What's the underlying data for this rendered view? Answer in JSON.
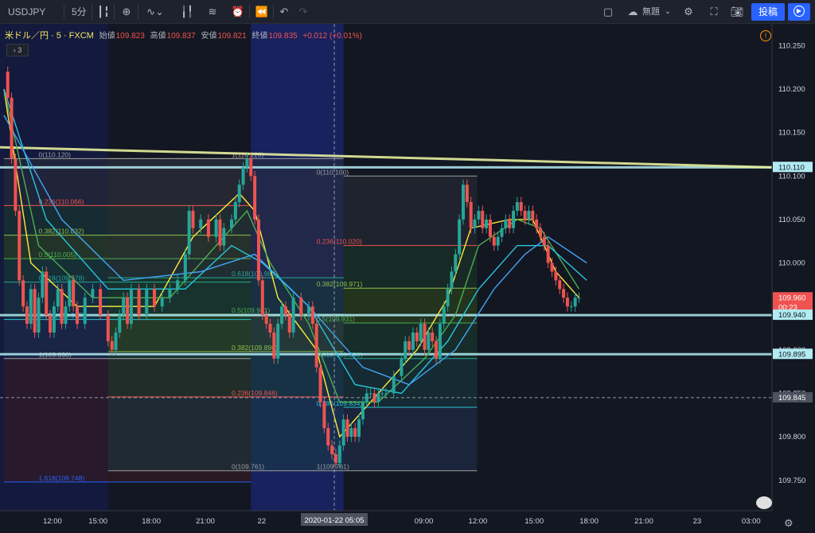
{
  "toolbar": {
    "symbol": "USDJPY",
    "interval": "5分",
    "autosave_label": "無題",
    "post_label": "投稿",
    "icons": [
      "candles-icon",
      "plus-circle-icon",
      "indicator-icon",
      "bar-chart-icon",
      "fib-icon",
      "alert-icon",
      "replay-icon",
      "undo-icon",
      "redo-icon",
      "square-icon",
      "cloud-icon",
      "gear-icon",
      "fullscreen-icon",
      "camera-icon",
      "play-icon"
    ]
  },
  "legend": {
    "symbol_desc": "米ドル／円 · 5 · FXCM",
    "open_label": "始値",
    "open": "109.823",
    "high_label": "高値",
    "high": "109.837",
    "low_label": "安値",
    "low": "109.821",
    "close_label": "終値",
    "close": "109.835",
    "change": "+0.012 (+0.01%)",
    "collapse": "› 3"
  },
  "colors": {
    "up": "#26a69a",
    "down": "#ef5350",
    "bg": "#131722",
    "cursor_bar": "#4c525e"
  },
  "chart_data": {
    "type": "line",
    "title": "",
    "ylabel": "",
    "xlabel": "",
    "ylim": [
      109.715,
      110.275
    ],
    "xlim": [
      0,
      100
    ],
    "grid": false,
    "x_ticks": [
      {
        "label": "12:00",
        "x": 6.8
      },
      {
        "label": "15:00",
        "x": 12.7
      },
      {
        "label": "18:00",
        "x": 19.6
      },
      {
        "label": "21:00",
        "x": 26.6
      },
      {
        "label": "22",
        "x": 33.9
      },
      {
        "label": "03:00",
        "x": 40.6
      },
      {
        "label": "09:00",
        "x": 54.9
      },
      {
        "label": "12:00",
        "x": 61.9
      },
      {
        "label": "15:00",
        "x": 69.2
      },
      {
        "label": "18:00",
        "x": 76.3
      },
      {
        "label": "21:00",
        "x": 83.4
      },
      {
        "label": "23",
        "x": 90.3
      },
      {
        "label": "03:00",
        "x": 97.3
      }
    ],
    "y_ticks": [
      "110.250",
      "110.200",
      "110.150",
      "110.100",
      "110.050",
      "110.000",
      "109.950",
      "109.900",
      "109.850",
      "109.800",
      "109.750"
    ],
    "price_series": [
      [
        0.5,
        110.22
      ],
      [
        1,
        110.19
      ],
      [
        1.5,
        110.12
      ],
      [
        2,
        110.06
      ],
      [
        2.5,
        109.98
      ],
      [
        3,
        109.95
      ],
      [
        3.5,
        109.93
      ],
      [
        4,
        109.97
      ],
      [
        4.5,
        109.92
      ],
      [
        5,
        109.96
      ],
      [
        5.5,
        109.99
      ],
      [
        6,
        109.94
      ],
      [
        6.5,
        109.92
      ],
      [
        7,
        109.95
      ],
      [
        7.5,
        109.97
      ],
      [
        8,
        109.93
      ],
      [
        8.5,
        109.95
      ],
      [
        9,
        109.98
      ],
      [
        9.5,
        109.95
      ],
      [
        10,
        109.93
      ],
      [
        11,
        109.96
      ],
      [
        12,
        109.97
      ],
      [
        13,
        109.94
      ],
      [
        14,
        109.91
      ],
      [
        14.5,
        109.9
      ],
      [
        15,
        109.92
      ],
      [
        15.5,
        109.94
      ],
      [
        16,
        109.96
      ],
      [
        16.5,
        109.93
      ],
      [
        17,
        109.97
      ],
      [
        18,
        109.94
      ],
      [
        19,
        109.97
      ],
      [
        20,
        109.95
      ],
      [
        21,
        109.96
      ],
      [
        22,
        109.97
      ],
      [
        23,
        109.98
      ],
      [
        24,
        110.01
      ],
      [
        24.5,
        110.06
      ],
      [
        25,
        110.04
      ],
      [
        26,
        110.05
      ],
      [
        27,
        110.03
      ],
      [
        28,
        110.05
      ],
      [
        28.5,
        110.02
      ],
      [
        29,
        110.04
      ],
      [
        30,
        110.05
      ],
      [
        30.5,
        110.07
      ],
      [
        31,
        110.09
      ],
      [
        31.5,
        110.11
      ],
      [
        32,
        110.12
      ],
      [
        32.5,
        110.1
      ],
      [
        33,
        110.05
      ],
      [
        33.5,
        109.98
      ],
      [
        34,
        109.94
      ],
      [
        34.5,
        109.93
      ],
      [
        35,
        109.92
      ],
      [
        35.5,
        109.89
      ],
      [
        36,
        109.93
      ],
      [
        36.5,
        109.95
      ],
      [
        37,
        109.94
      ],
      [
        37.5,
        109.92
      ],
      [
        38,
        109.96
      ],
      [
        39,
        109.94
      ],
      [
        40,
        109.95
      ],
      [
        40.5,
        109.93
      ],
      [
        41,
        109.88
      ],
      [
        41.5,
        109.84
      ],
      [
        42,
        109.81
      ],
      [
        42.5,
        109.79
      ],
      [
        43,
        109.78
      ],
      [
        43.5,
        109.77
      ],
      [
        44,
        109.79
      ],
      [
        44.5,
        109.82
      ],
      [
        45,
        109.8
      ],
      [
        45.5,
        109.81
      ],
      [
        46,
        109.8
      ],
      [
        46.5,
        109.82
      ],
      [
        47,
        109.84
      ],
      [
        47.5,
        109.85
      ],
      [
        48,
        109.85
      ],
      [
        48.5,
        109.84
      ],
      [
        49,
        109.85
      ],
      [
        49.5,
        109.85
      ],
      [
        50,
        109.85
      ],
      [
        51,
        109.87
      ],
      [
        52,
        109.89
      ],
      [
        52.5,
        109.91
      ],
      [
        53,
        109.9
      ],
      [
        53.5,
        109.92
      ],
      [
        54,
        109.91
      ],
      [
        54.5,
        109.93
      ],
      [
        55,
        109.9
      ],
      [
        55.5,
        109.92
      ],
      [
        56,
        109.91
      ],
      [
        56.5,
        109.89
      ],
      [
        57,
        109.93
      ],
      [
        57.5,
        109.95
      ],
      [
        58,
        109.97
      ],
      [
        58.5,
        109.99
      ],
      [
        59,
        110.01
      ],
      [
        59.5,
        110.05
      ],
      [
        60,
        110.09
      ],
      [
        60.5,
        110.07
      ],
      [
        61,
        110.04
      ],
      [
        61.5,
        110.05
      ],
      [
        62,
        110.06
      ],
      [
        62.5,
        110.04
      ],
      [
        63,
        110.05
      ],
      [
        63.5,
        110.03
      ],
      [
        64,
        110.02
      ],
      [
        64.5,
        110.03
      ],
      [
        65,
        110.04
      ],
      [
        65.5,
        110.05
      ],
      [
        66,
        110.04
      ],
      [
        66.5,
        110.06
      ],
      [
        67,
        110.07
      ],
      [
        67.5,
        110.06
      ],
      [
        68,
        110.05
      ],
      [
        68.5,
        110.06
      ],
      [
        69,
        110.05
      ],
      [
        69.5,
        110.04
      ],
      [
        70,
        110.03
      ],
      [
        70.5,
        110.02
      ],
      [
        71,
        110.0
      ],
      [
        71.5,
        109.99
      ],
      [
        72,
        109.98
      ],
      [
        72.5,
        109.97
      ],
      [
        73,
        109.96
      ],
      [
        73.5,
        109.95
      ],
      [
        74,
        109.95
      ],
      [
        74.5,
        109.96
      ],
      [
        75,
        109.96
      ]
    ],
    "ma_series": [
      {
        "color": "#ffeb3b",
        "points": [
          [
            0.5,
            110.2
          ],
          [
            4,
            110.0
          ],
          [
            10,
            109.95
          ],
          [
            20,
            109.95
          ],
          [
            25,
            110.03
          ],
          [
            31,
            110.08
          ],
          [
            33,
            110.06
          ],
          [
            36,
            109.96
          ],
          [
            41,
            109.9
          ],
          [
            44,
            109.8
          ],
          [
            48,
            109.84
          ],
          [
            54,
            109.9
          ],
          [
            58,
            109.96
          ],
          [
            61,
            110.04
          ],
          [
            66,
            110.05
          ],
          [
            69,
            110.05
          ],
          [
            72,
            109.99
          ],
          [
            75,
            109.96
          ]
        ]
      },
      {
        "color": "#4caf50",
        "points": [
          [
            0.5,
            110.2
          ],
          [
            5,
            110.02
          ],
          [
            12,
            109.96
          ],
          [
            22,
            109.96
          ],
          [
            27,
            110.01
          ],
          [
            32,
            110.06
          ],
          [
            35,
            110.0
          ],
          [
            40,
            109.93
          ],
          [
            44,
            109.84
          ],
          [
            49,
            109.84
          ],
          [
            55,
            109.89
          ],
          [
            59,
            109.94
          ],
          [
            62,
            110.02
          ],
          [
            67,
            110.05
          ],
          [
            70,
            110.04
          ],
          [
            75,
            109.97
          ]
        ]
      },
      {
        "color": "#26c6da",
        "points": [
          [
            0.5,
            110.2
          ],
          [
            6,
            110.05
          ],
          [
            14,
            109.97
          ],
          [
            24,
            109.97
          ],
          [
            30,
            110.02
          ],
          [
            34,
            110.0
          ],
          [
            40,
            109.95
          ],
          [
            46,
            109.86
          ],
          [
            52,
            109.85
          ],
          [
            58,
            109.91
          ],
          [
            62,
            109.97
          ],
          [
            67,
            110.02
          ],
          [
            71,
            110.02
          ],
          [
            76,
            109.98
          ]
        ]
      },
      {
        "color": "#42a5f5",
        "points": [
          [
            0.5,
            110.17
          ],
          [
            8,
            110.05
          ],
          [
            16,
            109.98
          ],
          [
            26,
            109.99
          ],
          [
            33,
            110.01
          ],
          [
            40,
            109.95
          ],
          [
            47,
            109.88
          ],
          [
            53,
            109.86
          ],
          [
            59,
            109.9
          ],
          [
            64,
            109.97
          ],
          [
            68,
            110.01
          ],
          [
            71,
            110.03
          ],
          [
            76,
            110.0
          ]
        ]
      }
    ],
    "fib_levels": [
      {
        "group": "A",
        "ratio": "0",
        "price": "110.120"
      },
      {
        "group": "A",
        "ratio": "0.236",
        "price": "110.066"
      },
      {
        "group": "A",
        "ratio": "0.382",
        "price": "110.032"
      },
      {
        "group": "A",
        "ratio": "0.5",
        "price": "110.005"
      },
      {
        "group": "A",
        "ratio": "0.618",
        "price": "109.978"
      },
      {
        "group": "A",
        "ratio": "0.786",
        "price": "109.935"
      },
      {
        "group": "A",
        "ratio": "1",
        "price": "109.890"
      },
      {
        "group": "A",
        "ratio": "1.618",
        "price": "109.748"
      },
      {
        "group": "B",
        "ratio": "1",
        "price": "110.120"
      },
      {
        "group": "B",
        "ratio": "0.618",
        "price": "109.983"
      },
      {
        "group": "B",
        "ratio": "0.5",
        "price": "109.941"
      },
      {
        "group": "B",
        "ratio": "0.382",
        "price": "109.898"
      },
      {
        "group": "B",
        "ratio": "0.236",
        "price": "109.846"
      },
      {
        "group": "B",
        "ratio": "0",
        "price": "109.761"
      },
      {
        "group": "C",
        "ratio": "0",
        "price": "110.100"
      },
      {
        "group": "C",
        "ratio": "0.236",
        "price": "110.020"
      },
      {
        "group": "C",
        "ratio": "0.382",
        "price": "109.971"
      },
      {
        "group": "C",
        "ratio": "0.5",
        "price": "109.931"
      },
      {
        "group": "C",
        "ratio": "0.618",
        "price": "109.890"
      },
      {
        "group": "C",
        "ratio": "0.786",
        "price": "109.834"
      },
      {
        "group": "C",
        "ratio": "1",
        "price": "109.761"
      }
    ],
    "price_labels": [
      {
        "text": "110.110",
        "price": 110.11,
        "bg": "#b2ebf2",
        "fg": "#131722"
      },
      {
        "text": "109.960",
        "price": 109.96,
        "bg": "#ef5350",
        "fg": "#ffffff"
      },
      {
        "text": "00:23",
        "price": 109.949,
        "bg": "#ef5350",
        "fg": "#ffffff"
      },
      {
        "text": "109.940",
        "price": 109.94,
        "bg": "#b2ebf2",
        "fg": "#131722"
      },
      {
        "text": "109.895",
        "price": 109.895,
        "bg": "#b2ebf2",
        "fg": "#131722"
      },
      {
        "text": "109.845",
        "price": 109.845,
        "bg": "#4c525e",
        "fg": "#ffffff"
      }
    ],
    "horizontal_lines": [
      110.11,
      109.94,
      109.895
    ],
    "trendline": [
      [
        0,
        110.133
      ],
      [
        100,
        110.11
      ]
    ],
    "crosshair": {
      "x": 43.3,
      "price": 109.845,
      "time_label": "2020-01-22 05:05"
    }
  }
}
